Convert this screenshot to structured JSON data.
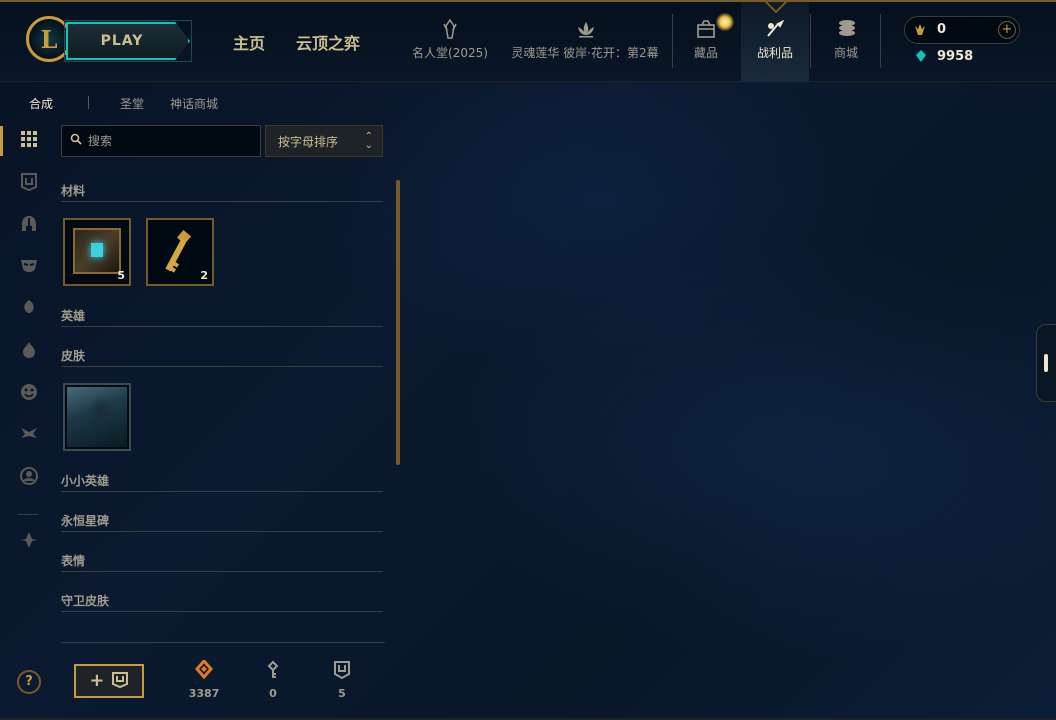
{
  "header": {
    "logo_letter": "L",
    "play_label": "PLAY",
    "main_nav": [
      "主页",
      "云顶之弈"
    ],
    "events": [
      {
        "label": "名人堂(2025)",
        "icon": "hall-of-fame-icon"
      },
      {
        "label": "灵魂莲华 彼岸·花开：第2幕",
        "icon": "lotus-icon"
      }
    ],
    "nav_items": [
      {
        "label": "藏品",
        "icon": "collection-icon"
      },
      {
        "label": "战利品",
        "icon": "loot-icon"
      },
      {
        "label": "商城",
        "icon": "store-icon"
      }
    ],
    "active_nav": "战利品",
    "currency": {
      "rp": "0",
      "blue_essence": "9958",
      "add_label": "+"
    }
  },
  "subtabs": [
    {
      "label": "合成",
      "active": true
    },
    {
      "label": "圣堂",
      "active": false
    },
    {
      "label": "神话商城",
      "active": false
    }
  ],
  "rail": {
    "icons": [
      "grid-icon",
      "chest-filter-icon",
      "champion-filter-icon",
      "skin-filter-icon",
      "ward-filter-icon",
      "little-legend-filter-icon",
      "emote-filter-icon",
      "eternals-filter-icon",
      "icon-filter-icon",
      "misc-filter-icon"
    ],
    "help_label": "?"
  },
  "search": {
    "placeholder": "搜索",
    "value": ""
  },
  "sort": {
    "label": "按字母排序"
  },
  "sections": [
    {
      "title": "材料",
      "items": [
        {
          "name": "海克斯科技宝箱",
          "count": "5",
          "art": "chest"
        },
        {
          "name": "海克斯科技钥匙",
          "count": "2",
          "art": "key"
        }
      ]
    },
    {
      "title": "英雄",
      "items": []
    },
    {
      "title": "皮肤",
      "items": [
        {
          "name": "皮肤碎片",
          "count": "",
          "art": "skin"
        }
      ]
    },
    {
      "title": "小小英雄",
      "items": []
    },
    {
      "title": "永恒星碑",
      "items": []
    },
    {
      "title": "表情",
      "items": []
    },
    {
      "title": "守卫皮肤",
      "items": []
    }
  ],
  "footer": {
    "add_chest_label": "+ ⛉",
    "stats": [
      {
        "icon": "orange-essence-icon",
        "value": "3387",
        "color": "#e07b24"
      },
      {
        "icon": "key-fragment-icon",
        "value": "0",
        "color": "#a09b8c"
      },
      {
        "icon": "chest-count-icon",
        "value": "5",
        "color": "#a09b8c"
      }
    ]
  }
}
